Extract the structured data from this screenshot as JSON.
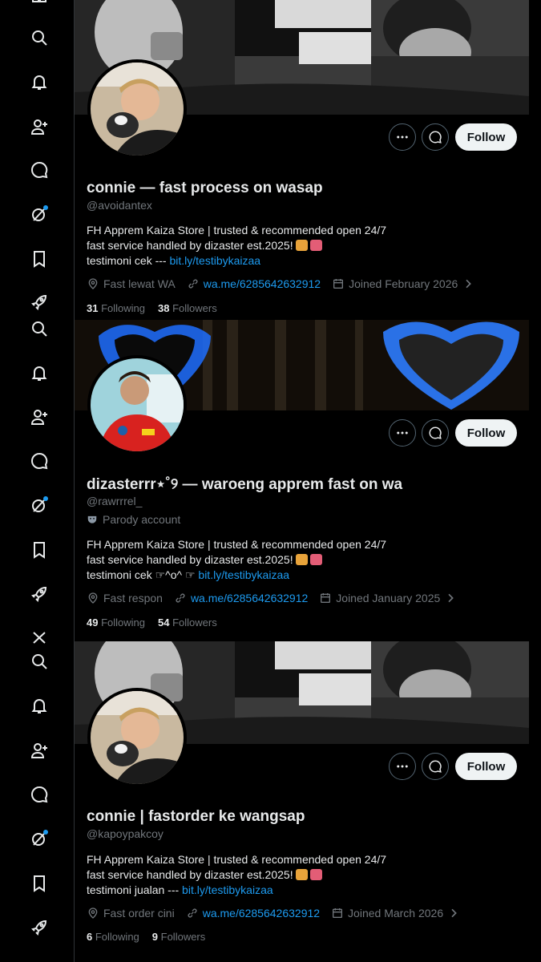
{
  "colors": {
    "accent": "#1d9bf0",
    "badge": "#1d9bf0",
    "muted": "#71767b"
  },
  "profiles": [
    {
      "display_name": "connie — fast process on wasap",
      "handle": "@avoidantex",
      "bio": [
        "FH Apprem Kaiza Store | trusted & recommended open 24/7",
        "fast service handled by dizaster est.2025!",
        "testimoni cek --- "
      ],
      "bio_link": "bit.ly/testibykaizaa",
      "location": "Fast lewat WA",
      "website": "wa.me/6285642632912",
      "joined": "Joined February 2026",
      "following_count": "31",
      "following_label": "Following",
      "followers_count": "38",
      "followers_label": "Followers",
      "follow_label": "Follow"
    },
    {
      "display_name": "dizasterrr⋆˚୨ — waroeng apprem fast on wa",
      "handle": "@rawrrrel_",
      "parody": "Parody account",
      "bio": [
        "FH Apprem Kaiza Store | trusted & recommended open 24/7",
        "fast service handled by dizaster est.2025!",
        "testimoni cek ☞^o^ ☞ "
      ],
      "bio_link": "bit.ly/testibykaizaa",
      "location": "Fast respon",
      "website": "wa.me/6285642632912",
      "joined": "Joined January 2025",
      "following_count": "49",
      "following_label": "Following",
      "followers_count": "54",
      "followers_label": "Followers",
      "follow_label": "Follow"
    },
    {
      "display_name": "connie | fastorder ke wangsap",
      "handle": "@kapoypakcoy",
      "bio": [
        "FH Apprem Kaiza Store | trusted & recommended open 24/7",
        "fast service handled by dizaster est.2025!",
        "testimoni jualan --- "
      ],
      "bio_link": "bit.ly/testibykaizaa",
      "location": "Fast order cini",
      "website": "wa.me/6285642632912",
      "joined": "Joined March 2026",
      "following_count": "6",
      "following_label": "Following",
      "followers_count": "9",
      "followers_label": "Followers",
      "follow_label": "Follow"
    }
  ]
}
